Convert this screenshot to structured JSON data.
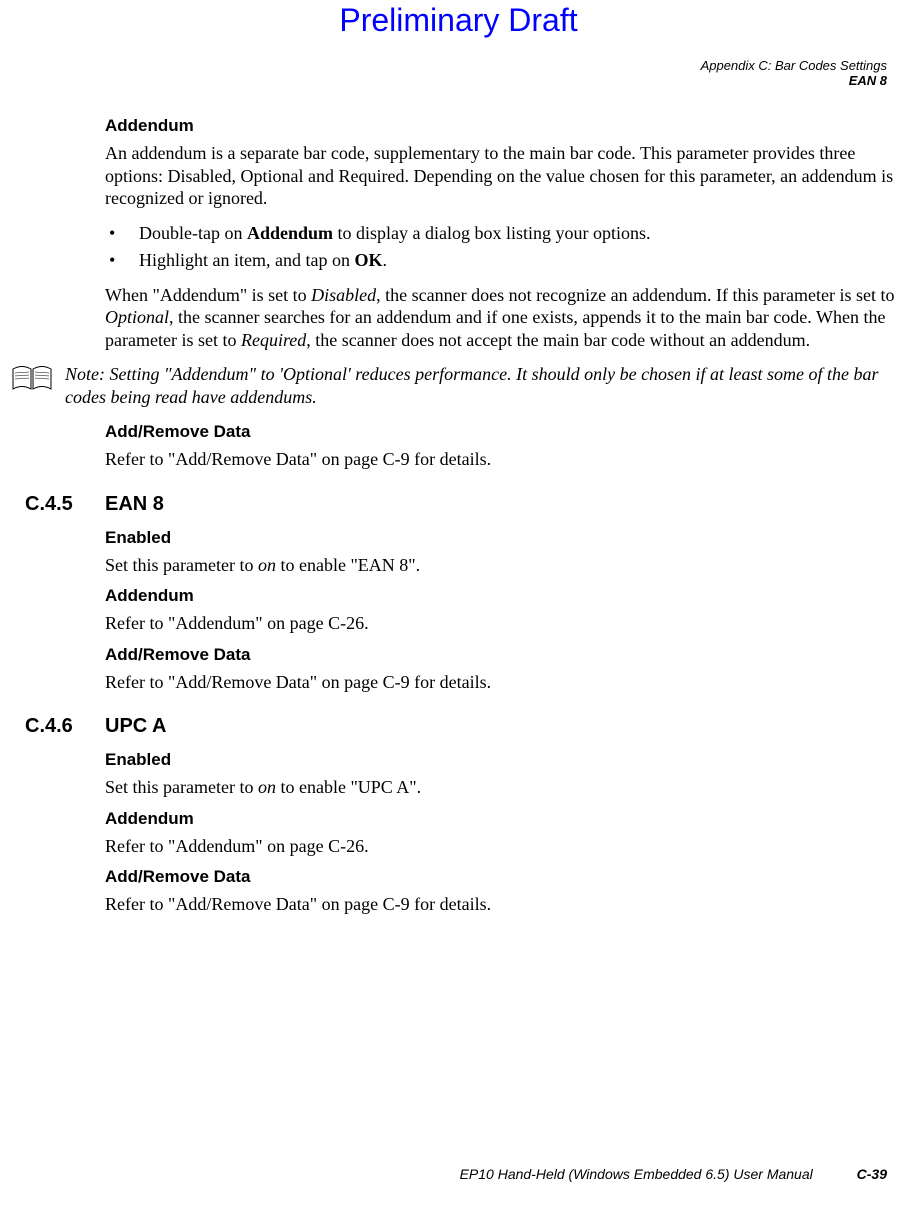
{
  "draft_header": "Preliminary Draft",
  "header": {
    "appendix_line": "Appendix C: Bar Codes Settings",
    "section_line": "EAN 8"
  },
  "addendum1": {
    "heading": "Addendum",
    "para1_a": "An addendum is a separate bar code, supplementary to the main bar code. This parameter provides three options: Disabled, Optional and Required. Depending on the value chosen for this parameter, an addendum is recognized or ignored.",
    "bullet1_a": "Double-tap on ",
    "bullet1_b": "Addendum",
    "bullet1_c": " to display a dialog box listing your options.",
    "bullet2_a": "Highlight an item, and tap on ",
    "bullet2_b": "OK",
    "bullet2_c": ".",
    "para2_a": "When \"Addendum\" is set to ",
    "para2_b": "Disabled",
    "para2_c": ", the scanner does not recognize an addendum. If this parameter is set to ",
    "para2_d": "Optional",
    "para2_e": ", the scanner searches for an addendum and if one exists, appends it to the main bar code. When the parameter is set to ",
    "para2_f": "Required",
    "para2_g": ", the scanner does not accept the main bar code without an addendum."
  },
  "note": {
    "label": "Note: ",
    "text": "Setting \"Addendum\" to 'Optional' reduces performance. It should only be chosen if at least some of the bar codes being read have addendums."
  },
  "addremove1": {
    "heading": "Add/Remove Data",
    "text": "Refer to \"Add/Remove Data\" on page C-9 for details."
  },
  "section_c45": {
    "num": "C.4.5",
    "title": "EAN 8",
    "enabled_heading": "Enabled",
    "enabled_a": "Set this parameter to ",
    "enabled_b": "on",
    "enabled_c": " to enable \"EAN 8\".",
    "add_heading": "Addendum",
    "add_text": "Refer to \"Addendum\" on page C-26.",
    "ard_heading": "Add/Remove Data",
    "ard_text": "Refer to \"Add/Remove Data\" on page C-9 for details."
  },
  "section_c46": {
    "num": "C.4.6",
    "title": "UPC A",
    "enabled_heading": "Enabled",
    "enabled_a": "Set this parameter to ",
    "enabled_b": "on",
    "enabled_c": " to enable \"UPC A\".",
    "add_heading": "Addendum",
    "add_text": "Refer to \"Addendum\" on page C-26.",
    "ard_heading": "Add/Remove Data",
    "ard_text": "Refer to \"Add/Remove Data\" on page C-9 for details."
  },
  "footer": {
    "text": "EP10 Hand-Held (Windows Embedded 6.5) User Manual",
    "page": "C-39"
  }
}
